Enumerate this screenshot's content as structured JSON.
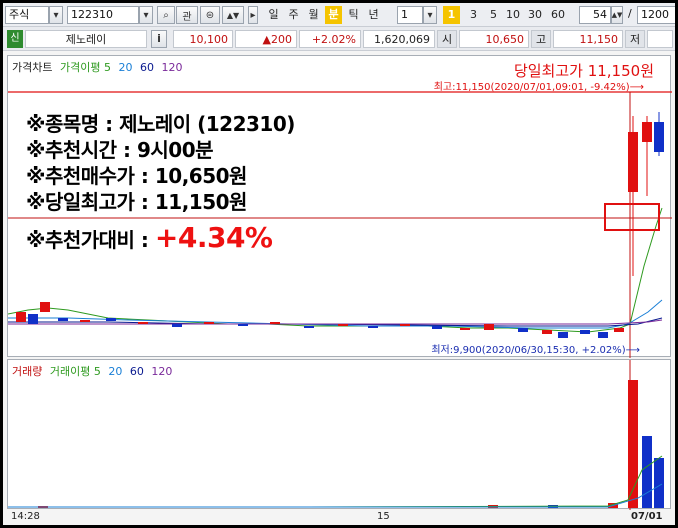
{
  "toolbar": {
    "market_select": "주식",
    "code_value": "122310",
    "search_label": "관",
    "periods": [
      "일",
      "주",
      "월",
      "분",
      "틱",
      "년"
    ],
    "active_period": "분",
    "interval_value": "1",
    "minute_buttons": [
      "1",
      "3",
      "5",
      "10",
      "30",
      "60"
    ],
    "active_minute": "1",
    "count_value": "54",
    "slash": "/",
    "total_value": "1200"
  },
  "quote": {
    "badge": "신",
    "name": "제노레이",
    "info_btn": "i",
    "price": "10,100",
    "change": "▲200",
    "change_pct": "+2.02%",
    "volume": "1,620,069",
    "open_label": "시",
    "open": "10,650",
    "high_label": "고",
    "high": "11,150",
    "low_label": "저"
  },
  "price_pane": {
    "legend": [
      {
        "text": "가격차트",
        "color": "#222222"
      },
      {
        "text": "가격이평 5",
        "color": "#2e9a1f"
      },
      {
        "text": "20",
        "color": "#1a7fd6"
      },
      {
        "text": "60",
        "color": "#0a1a8f"
      },
      {
        "text": "120",
        "color": "#7a2a9a"
      }
    ],
    "headline": "당일최고가 11,150원",
    "max_label": "최고:11,150(2020/07/01,09:01, -9.42%)⟶",
    "min_label": "최저:9,900(2020/06/30,15:30, +2.02%)⟶",
    "info": {
      "line1": "※종목명 : 제노레이 (122310)",
      "line2": "※추천시간 : 9시00분",
      "line3": "※추천매수가 : 10,650원",
      "line4": "※당일최고가 : 11,150원",
      "line5_prefix": "※추천가대비 : ",
      "line5_pct": "+4.34%"
    }
  },
  "volume_pane": {
    "legend": [
      {
        "text": "거래량",
        "color": "#c01010"
      },
      {
        "text": "거래이평 5",
        "color": "#2e9a1f"
      },
      {
        "text": "20",
        "color": "#1a7fd6"
      },
      {
        "text": "60",
        "color": "#0a1a8f"
      },
      {
        "text": "120",
        "color": "#7a2a9a"
      }
    ]
  },
  "time_axis": {
    "left": "14:28",
    "mid": "15",
    "right": "07/01"
  },
  "colors": {
    "up": "#e01010",
    "down": "#1030c8",
    "accent": "#f5c400"
  }
}
